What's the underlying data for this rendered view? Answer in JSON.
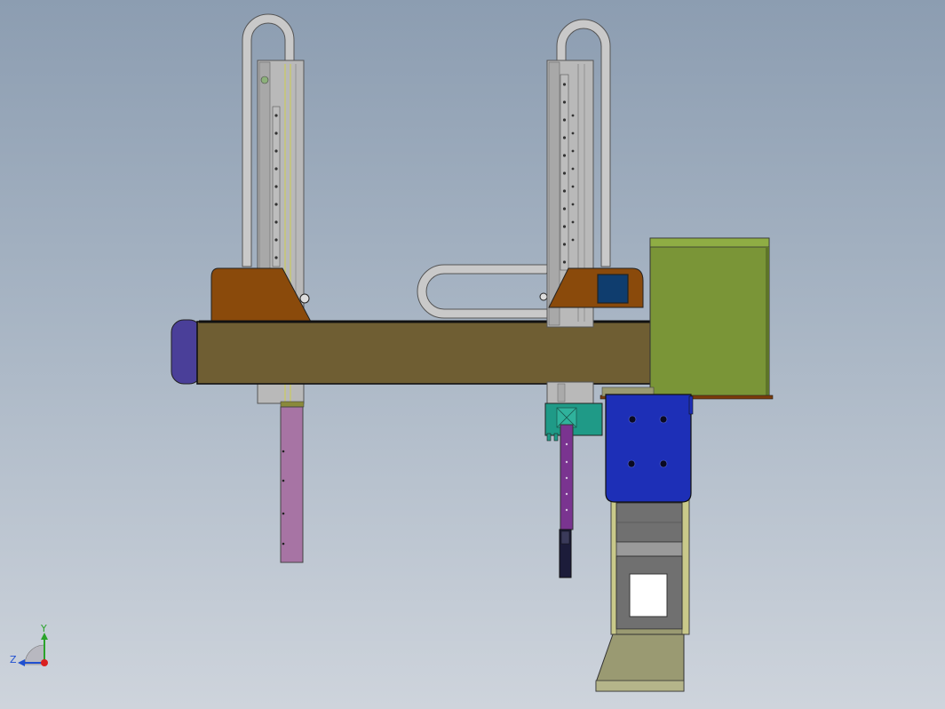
{
  "view": {
    "background_top": "#8c9db1",
    "background_bottom": "#ced4dc"
  },
  "colors": {
    "beam": "#6f5e33",
    "beam_cap": "#4a3f99",
    "carriage": "#8a4a0b",
    "cable_chain": "#c9c9c9",
    "rail": "#b9b9b9",
    "left_arm": "#a774a4",
    "right_arm": "#7a3490",
    "teal_block": "#1f9a87",
    "motor_box": "#7a9537",
    "blue_plate": "#1d2fb7",
    "base": "#9a9a72"
  },
  "triad": {
    "y_label": "Y",
    "z_label": "Z",
    "y_color": "#2aa32a",
    "x_color": "#d92020",
    "z_color": "#2050d0"
  }
}
